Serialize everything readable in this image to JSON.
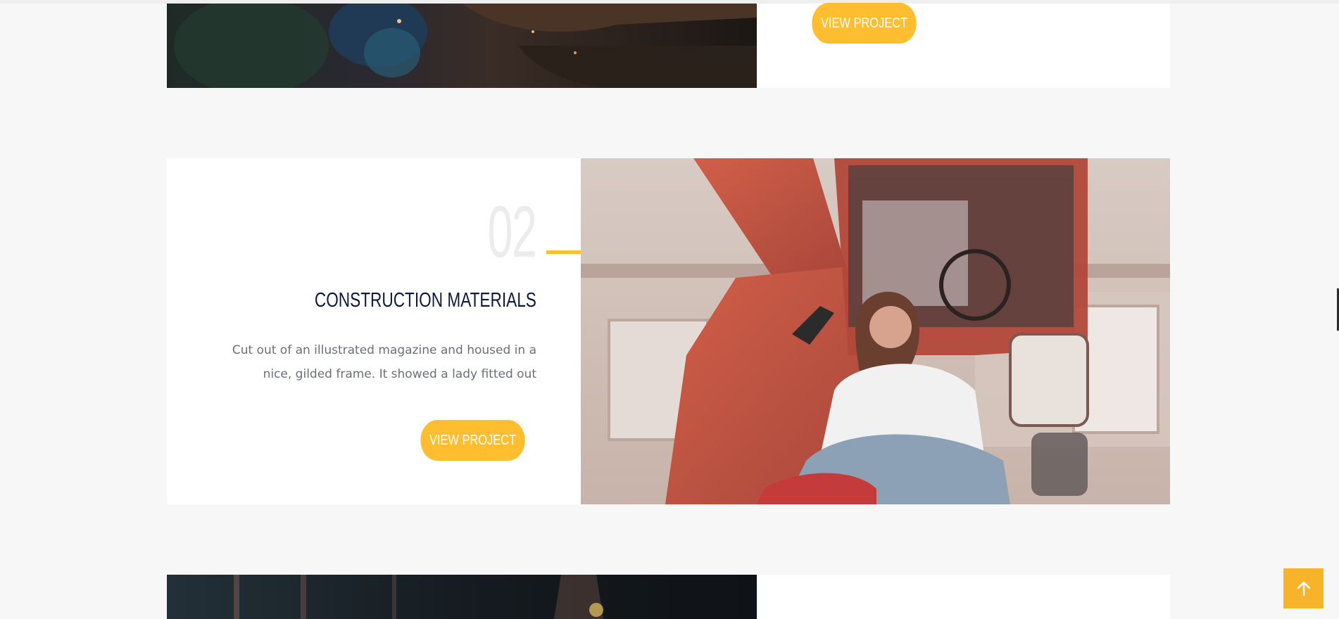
{
  "projects": [
    {
      "button_label": "VIEW PROJECT"
    },
    {
      "number": "02",
      "title": "CONSTRUCTION MATERIALS",
      "description_line1": "Cut out of an illustrated magazine and housed in a",
      "description_line2": "nice, gilded frame. It showed a lady fitted out",
      "button_label": "VIEW PROJECT"
    }
  ],
  "colors": {
    "accent": "#ffbd30",
    "title": "#0c1b3a",
    "text": "#6b6f76",
    "background": "#f7f7f7"
  },
  "icons": {
    "back_to_top": "arrow-up-icon"
  }
}
